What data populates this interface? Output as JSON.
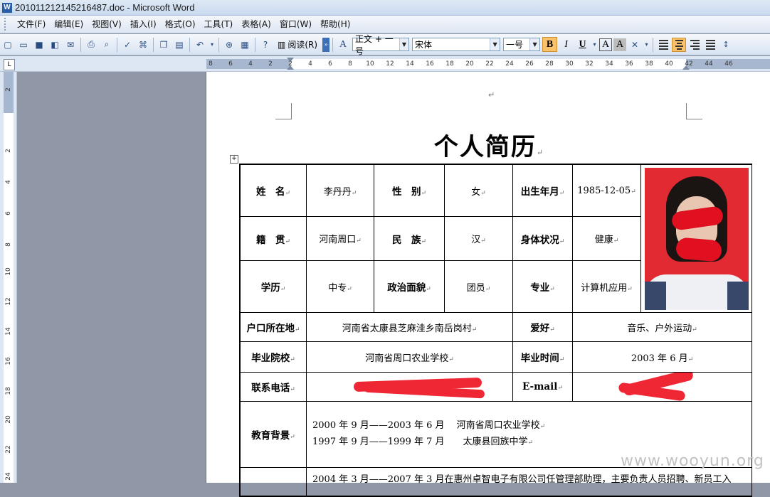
{
  "window": {
    "title": "20101121214521648​7.doc - Microsoft Word",
    "app_icon": "W"
  },
  "menu": [
    "文件(F)",
    "编辑(E)",
    "视图(V)",
    "插入(I)",
    "格式(O)",
    "工具(T)",
    "表格(A)",
    "窗口(W)",
    "帮助(H)"
  ],
  "toolbar": {
    "read_label": "阅读(R)",
    "style": "正文 + 一号",
    "font": "宋体",
    "size": "一号",
    "bold": "B",
    "italic": "I",
    "underline": "U",
    "char_border": "A",
    "char_shade": "A"
  },
  "ruler": {
    "h_ticks": [
      "8",
      "6",
      "4",
      "2",
      "2",
      "4",
      "6",
      "8",
      "10",
      "12",
      "14",
      "16",
      "18",
      "20",
      "22",
      "24",
      "26",
      "28",
      "30",
      "32",
      "34",
      "36",
      "38",
      "40",
      "42",
      "44",
      "46"
    ],
    "v_ticks": [
      "2",
      "2",
      "4",
      "6",
      "8",
      "10",
      "12",
      "14",
      "16",
      "18",
      "20",
      "22",
      "24"
    ]
  },
  "document": {
    "return_mark": "↵",
    "title": "个人简历",
    "resume": {
      "name_label": "姓　名",
      "name": "李丹丹",
      "gender_label": "性　别",
      "gender": "女",
      "birth_label": "出生年月",
      "birth": "1985-12-05",
      "native_label": "籍　贯",
      "native": "河南周口",
      "ethnic_label": "民　族",
      "ethnic": "汉",
      "health_label": "身体状况",
      "health": "健康",
      "edu_label": "学历",
      "edu": "中专",
      "political_label": "政治面貌",
      "political": "团员",
      "major_label": "专业",
      "major": "计算机应用",
      "hukou_label": "户口所在地",
      "hukou": "河南省太康县芝麻洼乡南岳岗村",
      "hobby_label": "爱好",
      "hobby": "音乐、户外运动",
      "school_label": "毕业院校",
      "school": "河南省周口农业学校",
      "grad_label": "毕业时间",
      "grad": "2003 年 6 月",
      "phone_label": "联系电话",
      "email_label": "E-mail",
      "edu_bg_label": "教育背景",
      "edu_bg_1": "2000 年 9 月——2003 年 6 月　 河南省周口农业学校",
      "edu_bg_2": "1997 年 9 月——1999 年 7 月　　太康县回族中学",
      "work_1": "2004 年 3 月——2007 年 3 月在惠州卓智电子有限公司任管理部助理，主要负责人员招聘、新员工入"
    }
  },
  "watermark": "www.wooyun.org"
}
